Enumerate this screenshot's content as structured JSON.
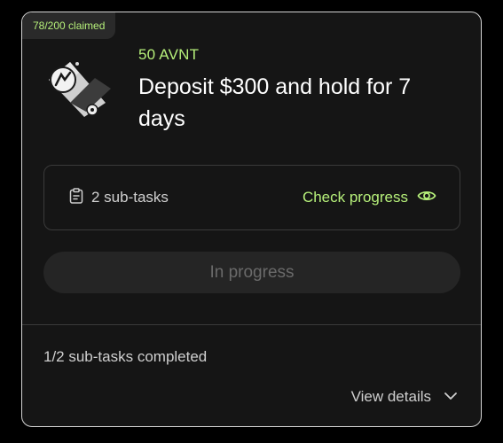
{
  "badge": {
    "claimed": "78/200 claimed"
  },
  "task": {
    "reward": "50 AVNT",
    "title": "Deposit $300 and hold for 7 days",
    "icon": "token-chart-icon"
  },
  "subtasks": {
    "count_label": "2 sub-tasks",
    "check_progress_label": "Check progress"
  },
  "status_button": {
    "label": "In progress"
  },
  "footer": {
    "completed_label": "1/2 sub-tasks completed",
    "view_details_label": "View details"
  },
  "colors": {
    "accent": "#b6f07a",
    "card_bg": "#151515",
    "card_border": "#d4d4d4",
    "button_bg": "#252525",
    "muted_text": "#6a6a6a"
  }
}
